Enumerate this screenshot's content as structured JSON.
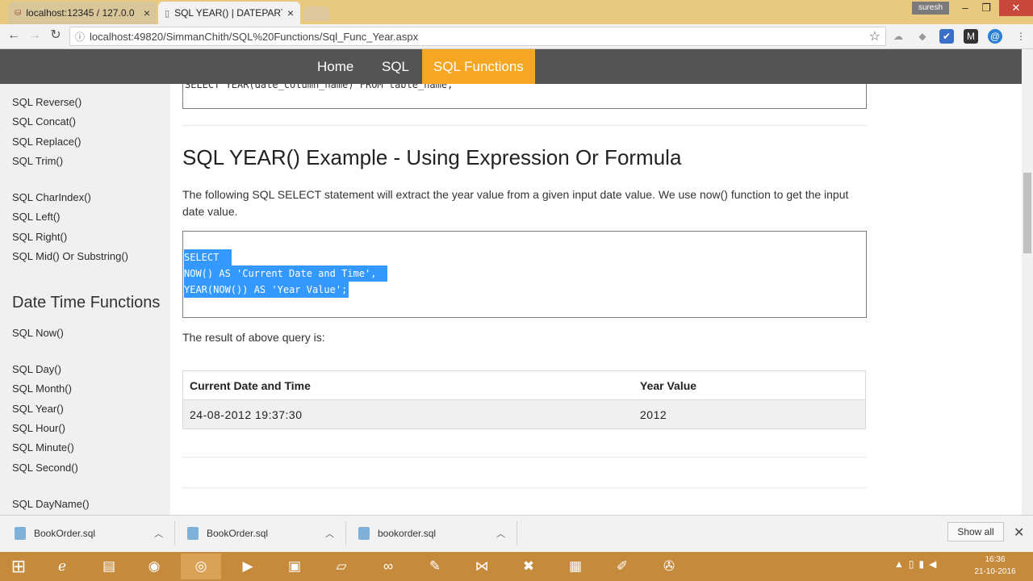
{
  "browser": {
    "tabs": [
      {
        "title": "localhost:12345 / 127.0.0"
      },
      {
        "title": "SQL YEAR() | DATEPART("
      }
    ],
    "profile": "suresh",
    "url": "localhost:49820/SimmanChith/SQL%20Functions/Sql_Func_Year.aspx"
  },
  "site_nav": {
    "items": [
      "Home",
      "SQL",
      "SQL Functions"
    ],
    "active": "SQL Functions",
    "active_color": "#f5a623",
    "bar_color": "#545454"
  },
  "sidebar": {
    "group1": [
      "SQL Reverse()",
      "SQL Concat()",
      "SQL Replace()",
      "SQL Trim()"
    ],
    "group2": [
      "SQL CharIndex()",
      "SQL Left()",
      "SQL Right()",
      "SQL Mid() Or Substring()"
    ],
    "heading": "Date Time Functions",
    "group3": [
      "SQL Now()"
    ],
    "group4": [
      "SQL Day()",
      "SQL Month()",
      "SQL Year()",
      "SQL Hour()",
      "SQL Minute()",
      "SQL Second()"
    ],
    "group5": [
      "SQL DayName()"
    ]
  },
  "main": {
    "top_code": "SELECT YEAR(date_column_name) FROM table_name;",
    "section_title": "SQL YEAR() Example - Using Expression Or Formula",
    "description": "The following SQL SELECT statement will extract the year value from a given input date value. We use now() function to get the input date value.",
    "code_lines": [
      "SELECT",
      "NOW() AS 'Current Date and Time',",
      "YEAR(NOW()) AS 'Year Value';"
    ],
    "result_intro": "The result of above query is:",
    "table": {
      "headers": [
        "Current Date and Time",
        "Year Value"
      ],
      "rows": [
        [
          "24-08-2012 19:37:30",
          "2012"
        ]
      ]
    }
  },
  "downloads": {
    "items": [
      "BookOrder.sql",
      "BookOrder.sql",
      "bookorder.sql"
    ],
    "show_all": "Show all"
  },
  "taskbar": {
    "time": "16:36",
    "date": "21-10-2016"
  }
}
